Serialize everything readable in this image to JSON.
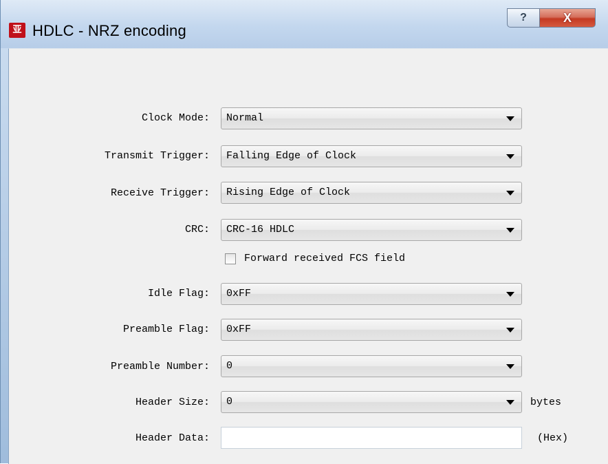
{
  "window": {
    "title": "HDLC - NRZ encoding",
    "help_label": "?",
    "close_label": "X"
  },
  "form": {
    "clock_mode": {
      "label": "Clock Mode:",
      "value": "Normal"
    },
    "transmit_trigger": {
      "label": "Transmit Trigger:",
      "value": "Falling Edge of Clock"
    },
    "receive_trigger": {
      "label": "Receive Trigger:",
      "value": "Rising Edge of Clock"
    },
    "crc": {
      "label": "CRC:",
      "value": "CRC-16 HDLC"
    },
    "forward_fcs": {
      "label": "Forward received FCS field",
      "checked": false
    },
    "idle_flag": {
      "label": "Idle Flag:",
      "value": "0xFF"
    },
    "preamble_flag": {
      "label": "Preamble Flag:",
      "value": "0xFF"
    },
    "preamble_number": {
      "label": "Preamble Number:",
      "value": "0"
    },
    "header_size": {
      "label": "Header Size:",
      "value": "0",
      "unit": "bytes"
    },
    "header_data": {
      "label": "Header Data:",
      "value": "",
      "unit": "(Hex)"
    }
  },
  "colors": {
    "titlebar": "#c3d7ee",
    "close_button": "#c43a22",
    "dialog_background": "#f0f0f0"
  }
}
